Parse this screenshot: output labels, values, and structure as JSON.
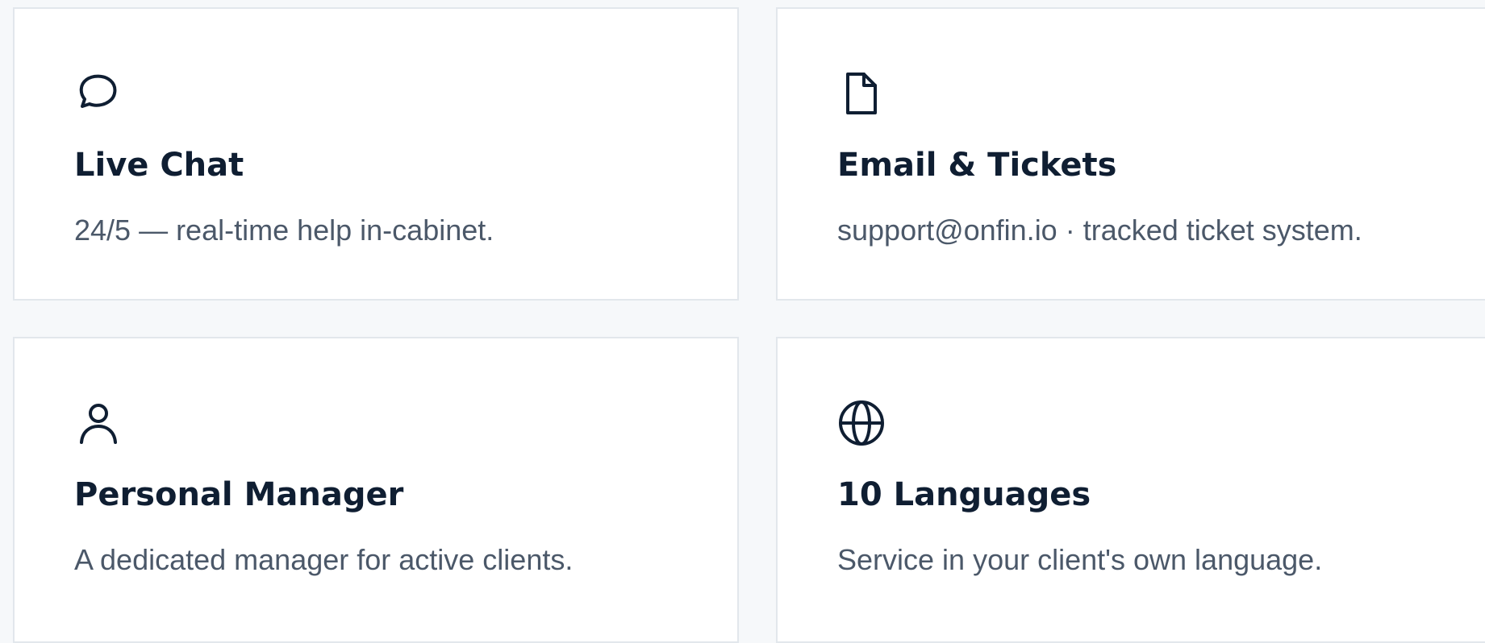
{
  "colors": {
    "page_background": "#f6f8fa",
    "card_background": "#ffffff",
    "card_border": "#e2e7ec",
    "title_color": "#0f1e32",
    "text_color": "#4b5869",
    "icon_color": "#0f1e32"
  },
  "cards": [
    {
      "icon": "chat-bubble-icon",
      "title": "Live Chat",
      "description": "24/5 — real-time help in-cabinet."
    },
    {
      "icon": "document-icon",
      "title": "Email & Tickets",
      "description": "support@onfin.io · tracked ticket system."
    },
    {
      "icon": "person-icon",
      "title": "Personal Manager",
      "description": "A dedicated manager for active clients."
    },
    {
      "icon": "globe-icon",
      "title": "10 Languages",
      "description": "Service in your client's own language."
    }
  ]
}
